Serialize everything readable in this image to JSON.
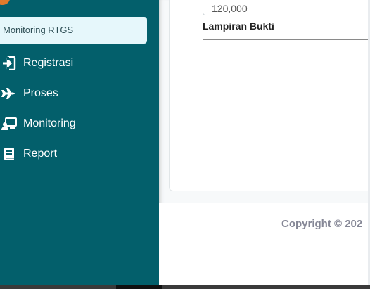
{
  "sidebar": {
    "active_sub_item": "Monitoring RTGS",
    "items": [
      {
        "label": "Registrasi",
        "icon": "sign-in-icon"
      },
      {
        "label": "Proses",
        "icon": "plane-icon"
      },
      {
        "label": "Monitoring",
        "icon": "monitor-user-icon"
      },
      {
        "label": "Report",
        "icon": "book-icon"
      }
    ]
  },
  "form": {
    "amount_value": "120,000",
    "attachment_label": "Lampiran Bukti"
  },
  "footer": {
    "copyright": "Copyright © 202"
  },
  "colors": {
    "sidebar_bg": "#035f6b",
    "active_item_bg": "#e6f7fb",
    "footer_text": "#858796"
  }
}
